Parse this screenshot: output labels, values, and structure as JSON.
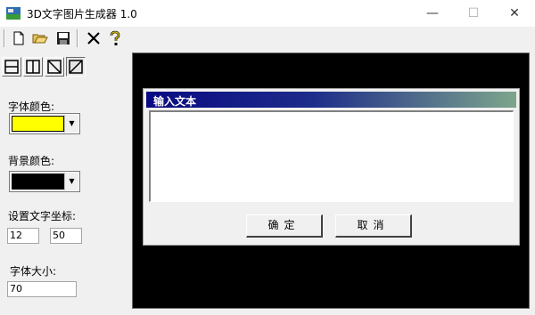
{
  "window": {
    "title": "3D文字图片生成器 1.0"
  },
  "title_buttons": {
    "minimize": "—",
    "maximize": "☐",
    "close": "✕"
  },
  "toolbar": {
    "icons": [
      "new-file-icon",
      "open-folder-icon",
      "save-icon",
      "delete-icon",
      "help-icon"
    ]
  },
  "mode_buttons": {
    "icons": [
      "horizontal-split-icon",
      "vertical-split-icon",
      "diagonal-down-icon",
      "diagonal-up-icon"
    ],
    "active_index": 3
  },
  "font_color": {
    "label": "字体颜色:",
    "value": "#ffff00"
  },
  "bg_color": {
    "label": "背景颜色:",
    "value": "#000000"
  },
  "coords": {
    "label": "设置文字坐标:",
    "x": "12",
    "y": "50"
  },
  "font_size": {
    "label": "字体大小:",
    "value": "70"
  },
  "dialog": {
    "title": "输入文本",
    "text": "",
    "ok_label": "确定",
    "cancel_label": "取消"
  }
}
